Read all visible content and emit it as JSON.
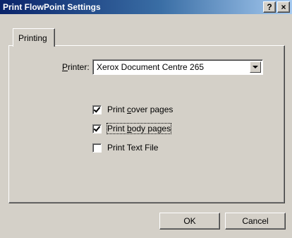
{
  "window": {
    "title": "Print FlowPoint Settings",
    "help_label": "?",
    "close_label": "×"
  },
  "tabs": [
    {
      "label": "Printing"
    }
  ],
  "printer": {
    "label_prefix": "",
    "label_mnemonic": "P",
    "label_rest": "rinter:",
    "value": "Xerox Document Centre 265"
  },
  "options": [
    {
      "pre": "Print ",
      "mnemonic": "c",
      "post": "over pages",
      "checked": true
    },
    {
      "pre": "Print ",
      "mnemonic": "b",
      "post": "ody pages",
      "checked": true
    },
    {
      "pre": "Print Text File",
      "mnemonic": "",
      "post": "",
      "checked": false
    }
  ],
  "buttons": {
    "ok_label": "OK",
    "cancel_label": "Cancel"
  }
}
